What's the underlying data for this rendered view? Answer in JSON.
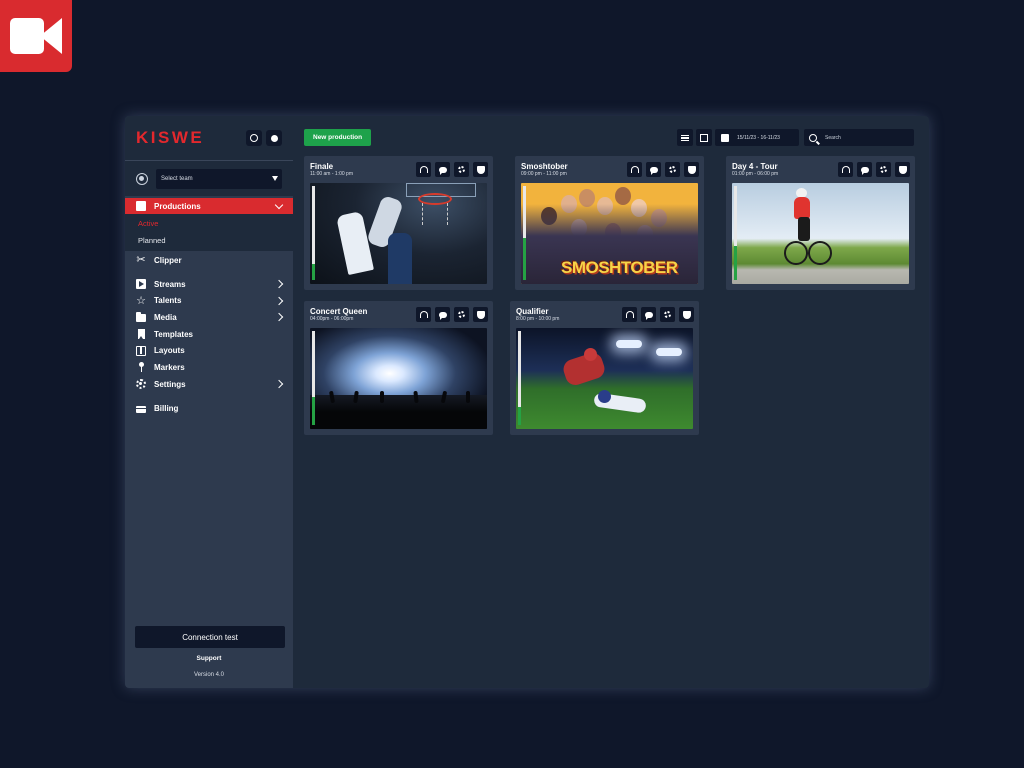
{
  "sidebar": {
    "brand": "KISWE",
    "team_select": "Select team",
    "productions_label": "Productions",
    "sub_items": [
      {
        "label": "Active"
      },
      {
        "label": "Planned"
      }
    ],
    "items": [
      {
        "label": "Clipper",
        "icon": "scissors-icon"
      },
      {
        "label": "Streams",
        "icon": "play-icon"
      },
      {
        "label": "Talents",
        "icon": "star-icon"
      },
      {
        "label": "Media",
        "icon": "folder-icon"
      },
      {
        "label": "Templates",
        "icon": "bookmark-icon"
      },
      {
        "label": "Layouts",
        "icon": "layout-icon"
      },
      {
        "label": "Markers",
        "icon": "pin-icon"
      },
      {
        "label": "Settings",
        "icon": "gear-icon"
      },
      {
        "label": "Billing",
        "icon": "card-icon"
      }
    ],
    "connection_test": "Connection test",
    "support": "Support",
    "version": "Version 4.0"
  },
  "toolbar": {
    "new_production": "New production",
    "date_range": "15/11/23 - 16-11/23",
    "search_placeholder": "Search"
  },
  "productions": [
    {
      "title": "Finale",
      "time": "11:00 am - 1:00 pm",
      "level": 0.17
    },
    {
      "title": "Smoshtober",
      "time": "09:00 pm - 11:00 pm",
      "level": 0.45
    },
    {
      "title": "Day 4 - Tour",
      "time": "01:00 pm - 06:00 pm",
      "level": 0.36
    },
    {
      "title": "Concert Queen",
      "time": "04:00pm - 06:00pm",
      "level": 0.3
    },
    {
      "title": "Qualifier",
      "time": "8:00 pm - 10:00 pm",
      "level": 0.19
    }
  ],
  "thumb_texts": {
    "smosh": "SMOSHTOBER"
  },
  "colors": {
    "brand": "#e3282d",
    "accent_green": "#1ea24b",
    "nav_active": "#d92b2f",
    "background": "#0f172a"
  }
}
